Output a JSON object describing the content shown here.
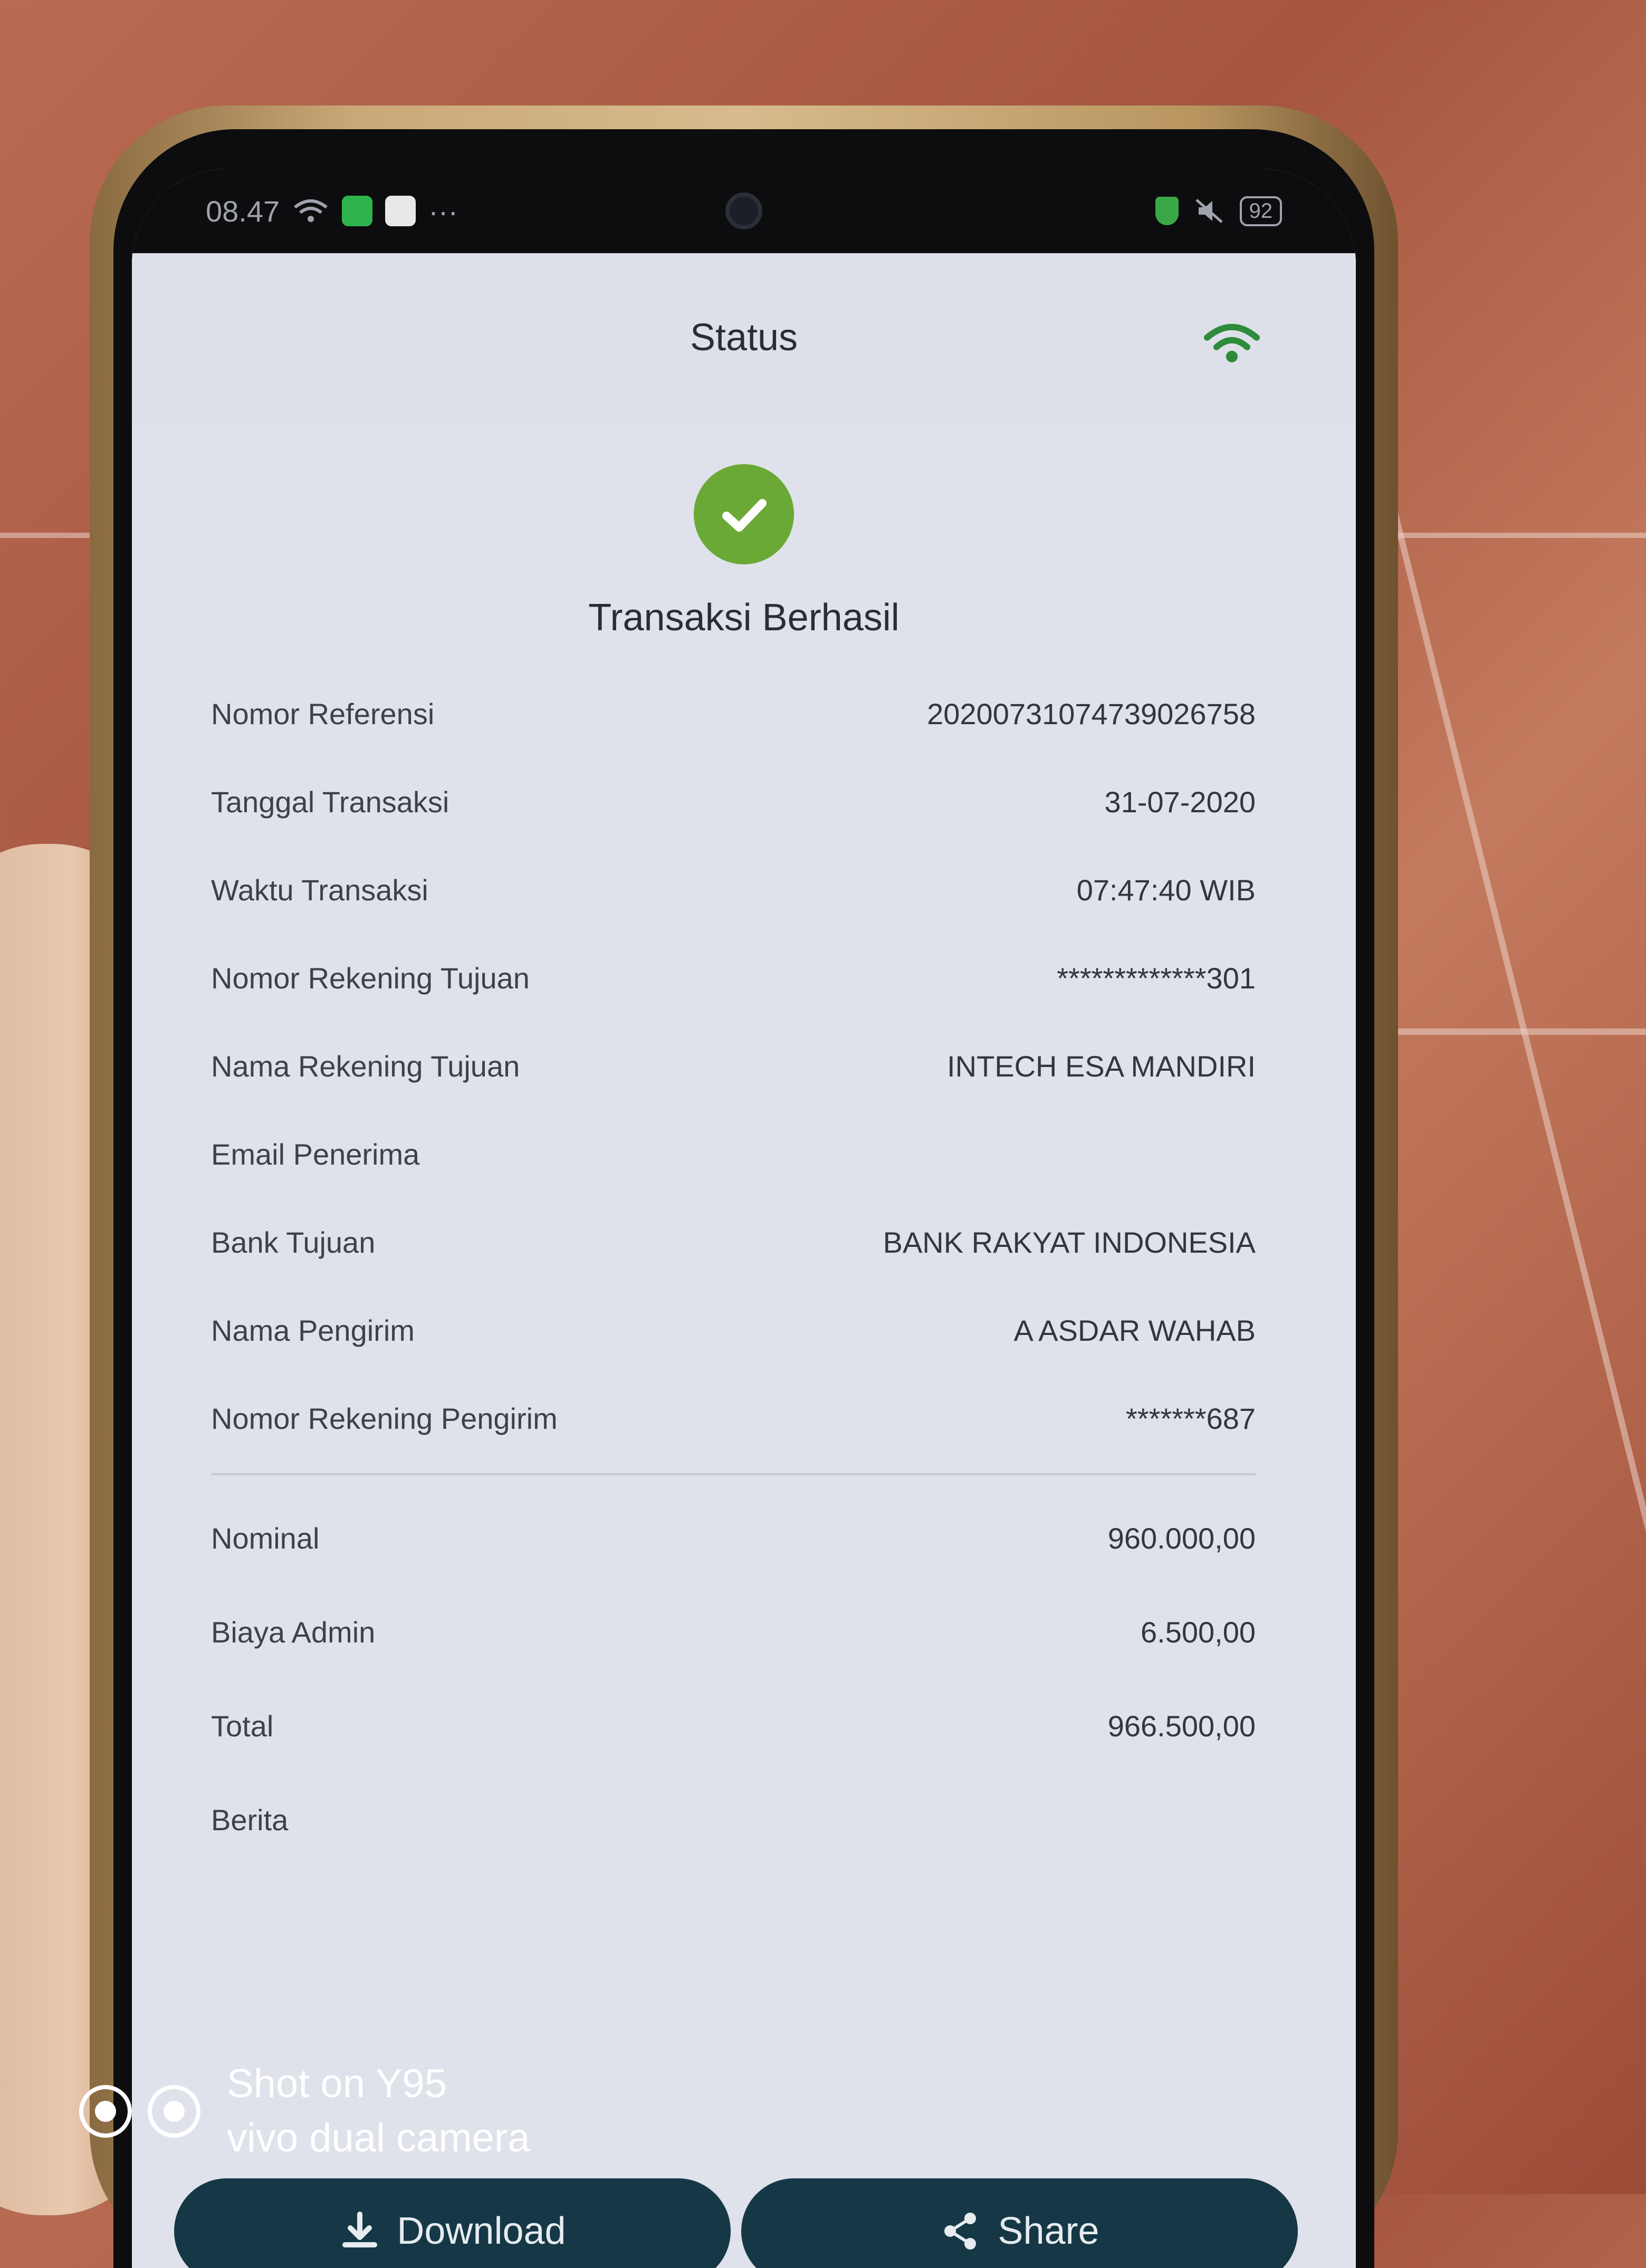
{
  "status_bar": {
    "time": "08.47",
    "battery": "92"
  },
  "header": {
    "title": "Status"
  },
  "result": {
    "title": "Transaksi Berhasil"
  },
  "details": [
    {
      "label": "Nomor Referensi",
      "value": "20200731074739026758"
    },
    {
      "label": "Tanggal Transaksi",
      "value": "31-07-2020"
    },
    {
      "label": "Waktu Transaksi",
      "value": "07:47:40 WIB"
    },
    {
      "label": "Nomor Rekening Tujuan",
      "value": "*************301"
    },
    {
      "label": "Nama Rekening Tujuan",
      "value": "INTECH ESA MANDIRI"
    },
    {
      "label": "Email Penerima",
      "value": ""
    },
    {
      "label": "Bank Tujuan",
      "value": "BANK RAKYAT INDONESIA"
    },
    {
      "label": "Nama Pengirim",
      "value": "A ASDAR WAHAB"
    },
    {
      "label": "Nomor Rekening Pengirim",
      "value": "*******687"
    }
  ],
  "amounts": [
    {
      "label": "Nominal",
      "value": "960.000,00"
    },
    {
      "label": "Biaya Admin",
      "value": "6.500,00"
    },
    {
      "label": "Total",
      "value": "966.500,00"
    },
    {
      "label": "Berita",
      "value": ""
    }
  ],
  "buttons": {
    "download_label": "Download",
    "share_label": "Share"
  },
  "watermark": {
    "line1": "Shot on Y95",
    "line2": "vivo dual camera"
  },
  "colors": {
    "success_green": "#6aa935",
    "button_dark": "#163846",
    "wifi_green": "#2e8b3a",
    "screen_bg": "#dfe2ea"
  },
  "icons": [
    "check-icon",
    "wifi-icon",
    "download-icon",
    "share-icon"
  ]
}
